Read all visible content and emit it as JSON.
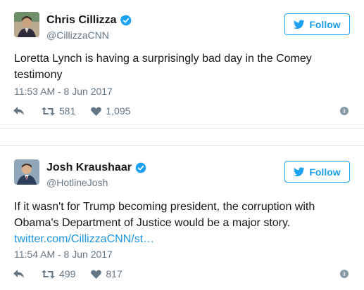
{
  "tweets": [
    {
      "name": "Chris Cillizza",
      "handle": "@CillizzaCNN",
      "follow_label": "Follow",
      "text": "Loretta Lynch is having a surprisingly bad day in the Comey testimony",
      "link": "",
      "timestamp": "11:53 AM - 8 Jun 2017",
      "retweets": "581",
      "likes": "1,095"
    },
    {
      "name": "Josh Kraushaar",
      "handle": "@HotlineJosh",
      "follow_label": "Follow",
      "text": "If it wasn't for Trump becoming president, the corruption with Obama's Department of Justice would be a major story.",
      "link": "twitter.com/CillizzaCNN/st…",
      "timestamp": "11:54 AM - 8 Jun 2017",
      "retweets": "499",
      "likes": "817"
    }
  ],
  "colors": {
    "accent": "#1da1f2",
    "link": "#1b95e0",
    "muted": "#657786",
    "verified": "#1da1f2"
  },
  "icons": [
    "twitter-bird-icon",
    "verified-badge-icon",
    "reply-icon",
    "retweet-icon",
    "heart-icon",
    "info-icon"
  ]
}
